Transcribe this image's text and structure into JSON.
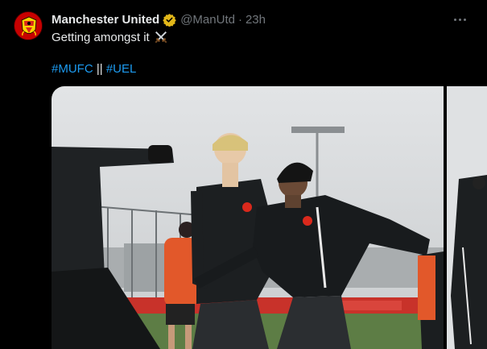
{
  "tweet": {
    "author_name": "Manchester United",
    "handle": "@ManUtd",
    "separator": "·",
    "time": "23h",
    "text": "Getting amongst it",
    "hashtags": [
      "#MUFC",
      "#UEL"
    ],
    "hashtag_separator": "||"
  },
  "icons": {
    "verified": "verified-badge-icon",
    "more": "more-options-icon",
    "emoji": "crossed-swords-emoji"
  },
  "media": {
    "photo_count_visible": 2,
    "main_photo": "Two players in black training jackets competing during a snowy training session",
    "second_photo": "Partial view of another training photo"
  },
  "colors": {
    "background": "#000000",
    "text": "#e7e9ea",
    "secondary_text": "#71767b",
    "link": "#1d9bf0",
    "verified_gold": "#e2b719",
    "brand_red": "#da291c"
  }
}
